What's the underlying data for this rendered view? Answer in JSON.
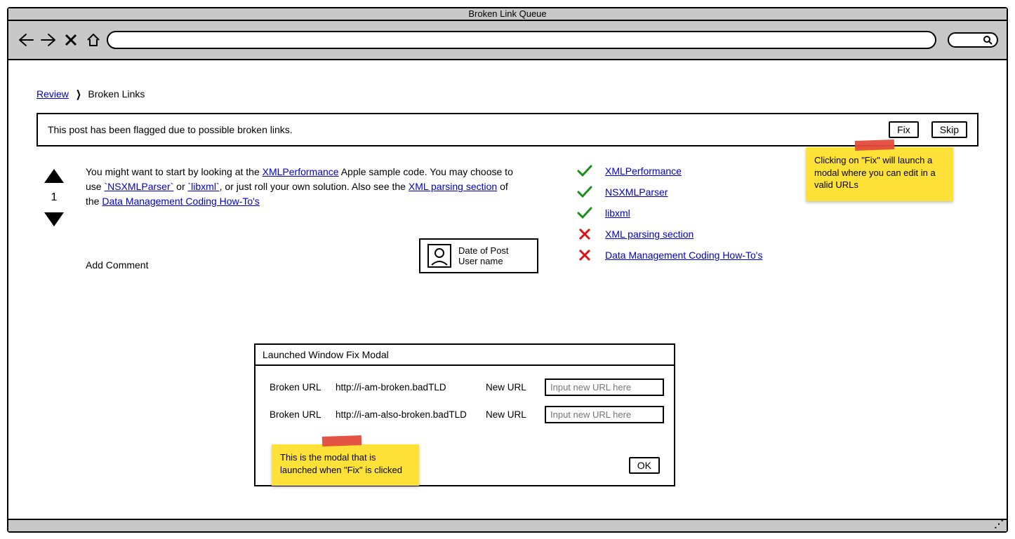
{
  "window": {
    "title": "Broken Link Queue"
  },
  "breadcrumb": {
    "root": "Review",
    "current": "Broken Links"
  },
  "flag": {
    "message": "This post has been flagged due to possible broken links.",
    "fix": "Fix",
    "skip": "Skip"
  },
  "note_fix": "Clicking on \"Fix\" will launch a modal where you can edit in a valid URLs",
  "note_modal": "This is the modal that is launched when \"Fix\" is clicked",
  "vote": {
    "score": "1"
  },
  "post": {
    "t1": "You might want to start by looking at the ",
    "l1": "XMLPerformance",
    "t2": " Apple sample code. You may choose to use ",
    "l2": "`NSXMLParser`",
    "t3": " or ",
    "l3": "`libxml`",
    "t4": ", or just roll your own solution. Also see the ",
    "l4": "XML parsing section",
    "t5": " of the ",
    "l5": "Data Management Coding How-To's"
  },
  "add_comment": "Add Comment",
  "sig": {
    "date": "Date of Post",
    "user": "User name"
  },
  "links": [
    {
      "ok": true,
      "text": "XMLPerformance"
    },
    {
      "ok": true,
      "text": "NSXMLParser"
    },
    {
      "ok": true,
      "text": "libxml"
    },
    {
      "ok": false,
      "text": "XML parsing section"
    },
    {
      "ok": false,
      "text": "Data Management Coding How-To's"
    }
  ],
  "modal": {
    "title": "Launched Window Fix Modal",
    "broken_label": "Broken URL",
    "new_label": "New URL",
    "placeholder": "Input new URL here",
    "ok": "OK",
    "rows": [
      {
        "url": "http://i-am-broken.badTLD"
      },
      {
        "url": "http://i-am-also-broken.badTLD"
      }
    ]
  }
}
